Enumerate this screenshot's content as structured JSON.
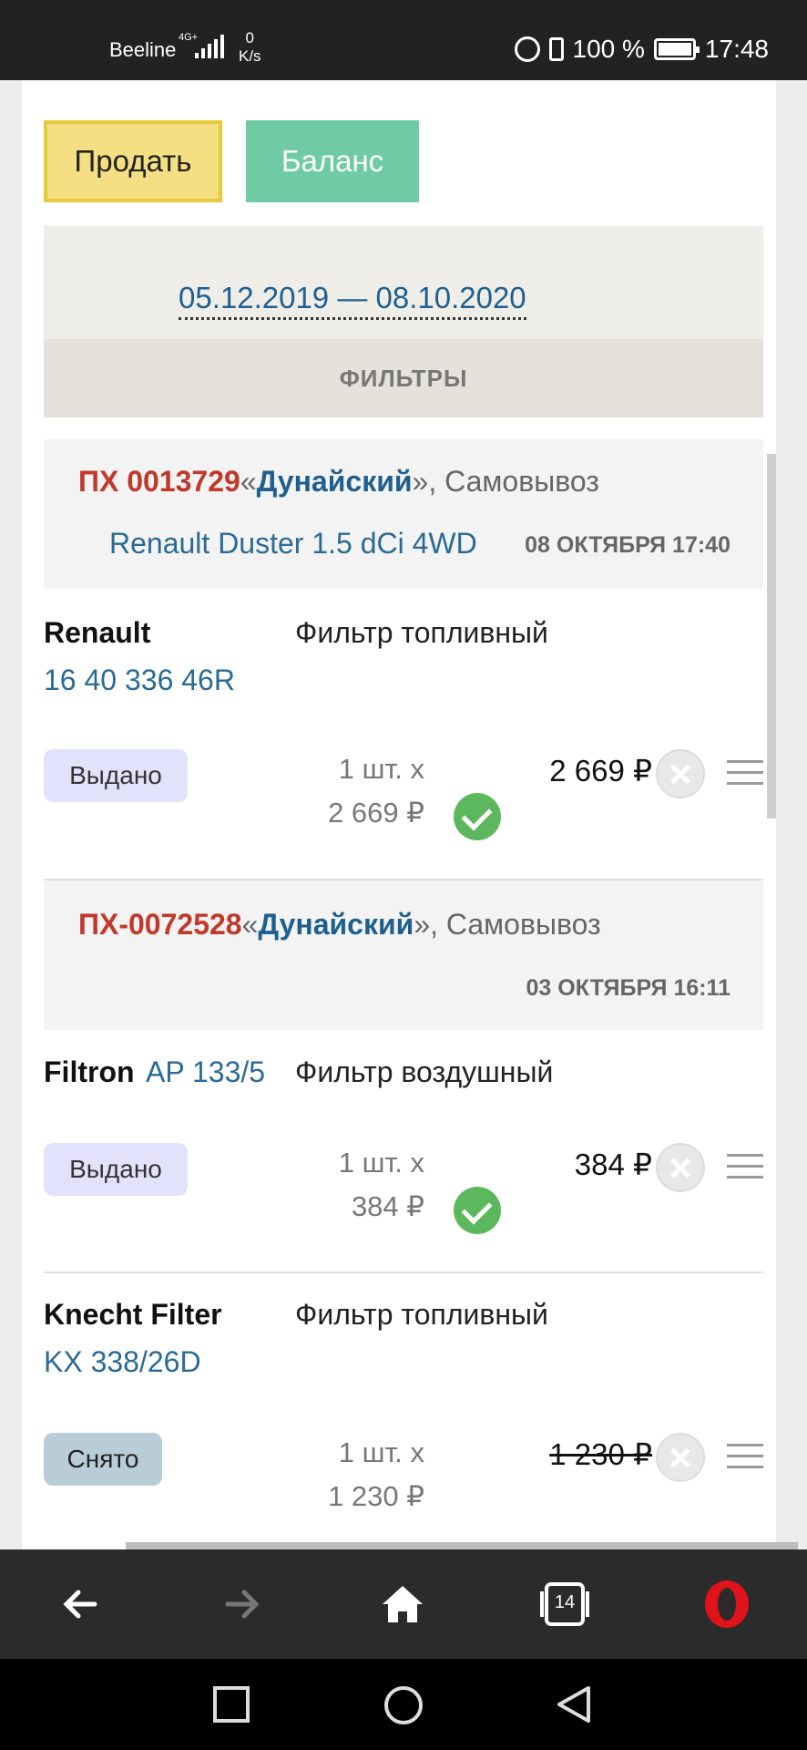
{
  "status_bar": {
    "carrier": "Beeline",
    "network": "4G+",
    "speed_value": "0",
    "speed_unit": "K/s",
    "battery": "100 %",
    "time": "17:48"
  },
  "actions": {
    "sell_label": "Продать",
    "balance_label": "Баланс"
  },
  "filter": {
    "date_range": "05.12.2019 — 08.10.2020",
    "filters_label": "ФИЛЬТРЫ"
  },
  "orders": [
    {
      "number": "ПХ 0013729",
      "open_quote": "«",
      "store": "Дунайский",
      "close_quote": "»",
      "delivery": ", Самовывоз",
      "car": "Renault Duster 1.5 dCi 4WD",
      "date": "08 ОКТЯБРЯ 17:40",
      "items": [
        {
          "brand": "Renault",
          "article": "16 40 336 46R",
          "name": "Фильтр топливный",
          "status": "Выдано",
          "qty": "1 шт. x",
          "unit_price": "2 669 ₽",
          "total": "2 669 ₽"
        }
      ]
    },
    {
      "number": "ПХ-0072528",
      "open_quote": "«",
      "store": "Дунайский",
      "close_quote": "»",
      "delivery": ", Самовывоз",
      "car": "",
      "date": "03 ОКТЯБРЯ 16:11",
      "items": [
        {
          "brand": "Filtron",
          "article": "AP 133/5",
          "name": "Фильтр воздушный",
          "status": "Выдано",
          "qty": "1 шт. x",
          "unit_price": "384 ₽",
          "total": "384 ₽"
        },
        {
          "brand": "Knecht Filter",
          "article": "KX 338/26D",
          "name": "Фильтр топливный",
          "status": "Снято",
          "qty": "1 шт. x",
          "unit_price": "1 230 ₽",
          "total": "1 230 ₽"
        }
      ]
    }
  ],
  "browser_bar": {
    "tabs_count": "14",
    "colors": {
      "opera_red": "#e0131a",
      "accent_blue": "#1f5f8f",
      "order_red": "#c0392b"
    }
  },
  "icons": [
    "back-icon",
    "forward-icon",
    "home-icon",
    "tabs-icon",
    "opera-icon",
    "square-nav-icon",
    "circle-nav-icon",
    "triangle-back-nav-icon"
  ]
}
